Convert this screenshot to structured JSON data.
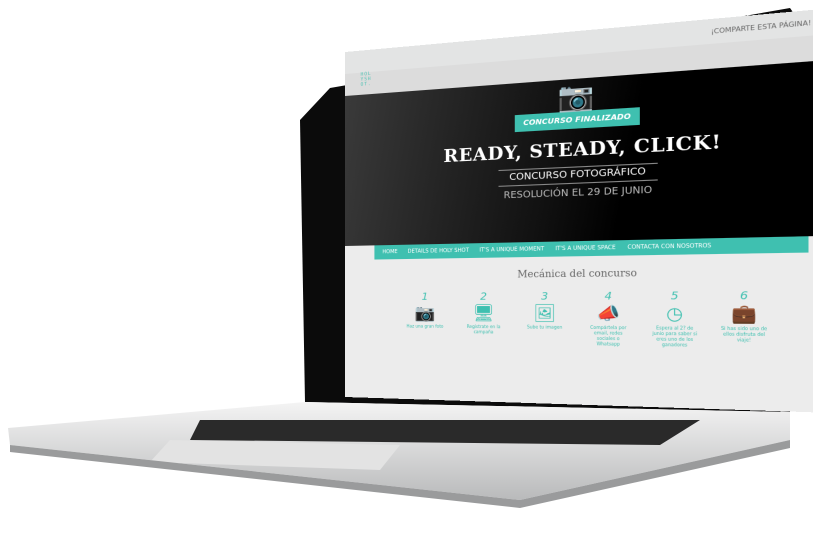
{
  "topbar": {
    "share_label": "¡COMPARTE ESTA PÁGINA!",
    "share_icon": "share-icon"
  },
  "logo": {
    "lines": [
      "HOL",
      "YSH",
      "OT."
    ]
  },
  "hero": {
    "badge": "CONCURSO FINALIZADO",
    "title": "READY, STEADY, CLICK!",
    "subtitle": "CONCURSO FOTOGRÁFICO",
    "resolution": "RESOLUCIÓN EL 29 DE JUNIO",
    "camera_icon": "camera-icon"
  },
  "nav": {
    "items": [
      "HOME",
      "DETAILS DE HOLY SHOT",
      "IT'S A UNIQUE MOMENT",
      "IT'S A UNIQUE SPACE",
      "CONTACTA CON NOSOTROS"
    ]
  },
  "main": {
    "heading": "Mecánica del concurso",
    "steps": [
      {
        "num": "1",
        "icon": "camera-icon",
        "glyph": "📷",
        "text": "Haz una gran foto"
      },
      {
        "num": "2",
        "icon": "monitor-icon",
        "glyph": "🖥",
        "text": "Regístrate en la campaña"
      },
      {
        "num": "3",
        "icon": "image-icon",
        "glyph": "🖼",
        "text": "Sube tu imagen"
      },
      {
        "num": "4",
        "icon": "megaphone-icon",
        "glyph": "📣",
        "text": "Compártela por email, redes sociales o Whatsapp"
      },
      {
        "num": "5",
        "icon": "clock-icon",
        "glyph": "◷",
        "text": "Espera al 2? de junio para saber si eres uno de los ganadores"
      },
      {
        "num": "6",
        "icon": "suitcase-icon",
        "glyph": "💼",
        "text": "Si has sido uno de ellos disfruta del viaje!"
      }
    ]
  },
  "colors": {
    "accent": "#3fc0b0",
    "bezel": "#0a0a0a",
    "body": "#d9dadb"
  }
}
